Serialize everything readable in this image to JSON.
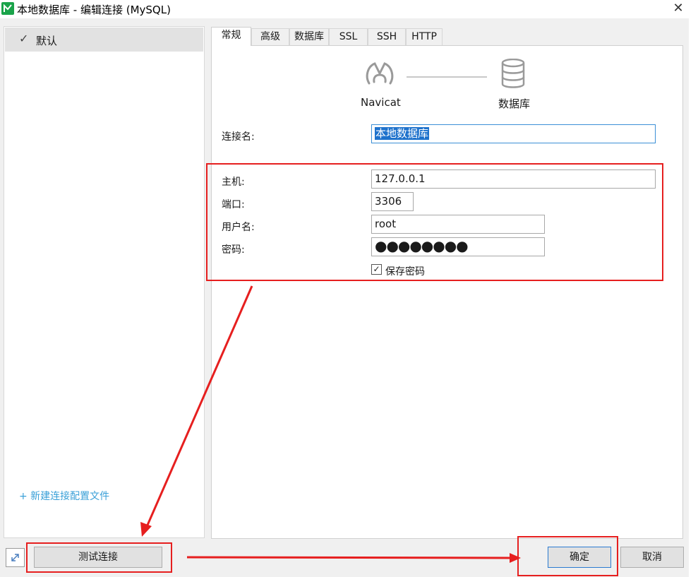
{
  "window": {
    "title": "本地数据库 - 编辑连接 (MySQL)",
    "close_glyph": "✕"
  },
  "sidebar": {
    "profile_label": "默认",
    "check_glyph": "✓",
    "new_profile_link": "+ 新建连接配置文件"
  },
  "tabs": [
    {
      "label": "常规",
      "active": true
    },
    {
      "label": "高级"
    },
    {
      "label": "数据库"
    },
    {
      "label": "SSL"
    },
    {
      "label": "SSH"
    },
    {
      "label": "HTTP"
    }
  ],
  "diagram": {
    "left_caption": "Navicat",
    "right_caption": "数据库",
    "left_icon": "navicat-logo-icon",
    "right_icon": "database-icon"
  },
  "form": {
    "conn_name_label": "连接名:",
    "conn_name_value": "本地数据库",
    "host_label": "主机:",
    "host_value": "127.0.0.1",
    "port_label": "端口:",
    "port_value": "3306",
    "user_label": "用户名:",
    "user_value": "root",
    "password_label": "密码:",
    "password_value": "●●●●●●●●",
    "save_password_label": "保存密码",
    "save_password_checked": true,
    "check_glyph": "✓"
  },
  "buttons": {
    "test": "测试连接",
    "ok": "确定",
    "cancel": "取消"
  },
  "colors": {
    "annotation_red": "#e61f1f",
    "link_blue": "#3aa0d8",
    "selection_blue": "#1e72cc"
  }
}
